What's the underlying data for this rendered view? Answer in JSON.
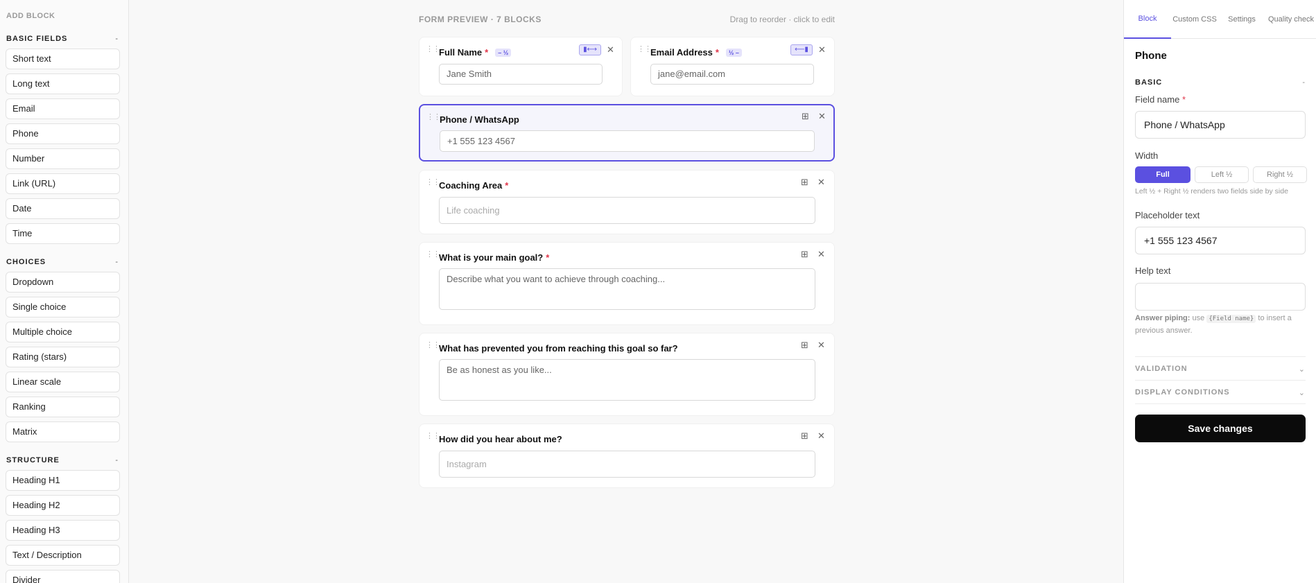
{
  "sidebar": {
    "title": "ADD BLOCK",
    "sections": [
      {
        "title": "BASIC FIELDS",
        "toggle": "-",
        "items": [
          "Short text",
          "Long text",
          "Email",
          "Phone",
          "Number",
          "Link (URL)",
          "Date",
          "Time"
        ]
      },
      {
        "title": "CHOICES",
        "toggle": "-",
        "items": [
          "Dropdown",
          "Single choice",
          "Multiple choice",
          "Rating (stars)",
          "Linear scale",
          "Ranking",
          "Matrix"
        ]
      },
      {
        "title": "STRUCTURE",
        "toggle": "-",
        "items": [
          "Heading H1",
          "Heading H2",
          "Heading H3",
          "Text / Description",
          "Divider"
        ]
      }
    ]
  },
  "preview": {
    "title": "FORM PREVIEW · 7 BLOCKS",
    "hint": "Drag to reorder · click to edit",
    "blocks": [
      {
        "label": "Full Name",
        "required": "*",
        "badge": "– ½",
        "placeholder": "Jane Smith",
        "width_icon": "▮⟷"
      },
      {
        "label": "Email Address",
        "required": "*",
        "badge": "½ –",
        "placeholder": "jane@email.com",
        "width_icon": "⟵▮"
      },
      {
        "label": "Phone / WhatsApp",
        "required": "",
        "placeholder": "+1 555 123 4567"
      },
      {
        "label": "Coaching Area",
        "required": "*",
        "placeholder": "Life coaching"
      },
      {
        "label": "What is your main goal?",
        "required": "*",
        "placeholder": "Describe what you want to achieve through coaching..."
      },
      {
        "label": "What has prevented you from reaching this goal so far?",
        "required": "",
        "placeholder": "Be as honest as you like..."
      },
      {
        "label": "How did you hear about me?",
        "required": "",
        "placeholder": "Instagram"
      }
    ],
    "icons": {
      "grip": "⋮⋮",
      "width": "⊞",
      "remove": "✕"
    }
  },
  "panel": {
    "tabs": [
      "Block",
      "Custom CSS",
      "Settings",
      "Quality check"
    ],
    "title": "Phone",
    "basic_section": "BASIC",
    "basic_toggle": "-",
    "field_name_label": "Field name",
    "field_name_required": "*",
    "field_name_value": "Phone / WhatsApp",
    "width_label": "Width",
    "width_options": [
      "Full",
      "Left ½",
      "Right ½"
    ],
    "width_note": "Left ½ + Right ½ renders two fields side by side",
    "placeholder_label": "Placeholder text",
    "placeholder_value": "+1 555 123 4567",
    "help_label": "Help text",
    "help_value": "",
    "piping_bold": "Answer piping:",
    "piping_pre": " use ",
    "piping_code": "{Field name}",
    "piping_post": " to insert a previous answer.",
    "validation": "VALIDATION",
    "display_conditions": "DISPLAY CONDITIONS",
    "collapse_icon": "⌄",
    "save": "Save changes"
  },
  "colors": {
    "accent": "#5b50e0",
    "required": "#e0364a"
  }
}
